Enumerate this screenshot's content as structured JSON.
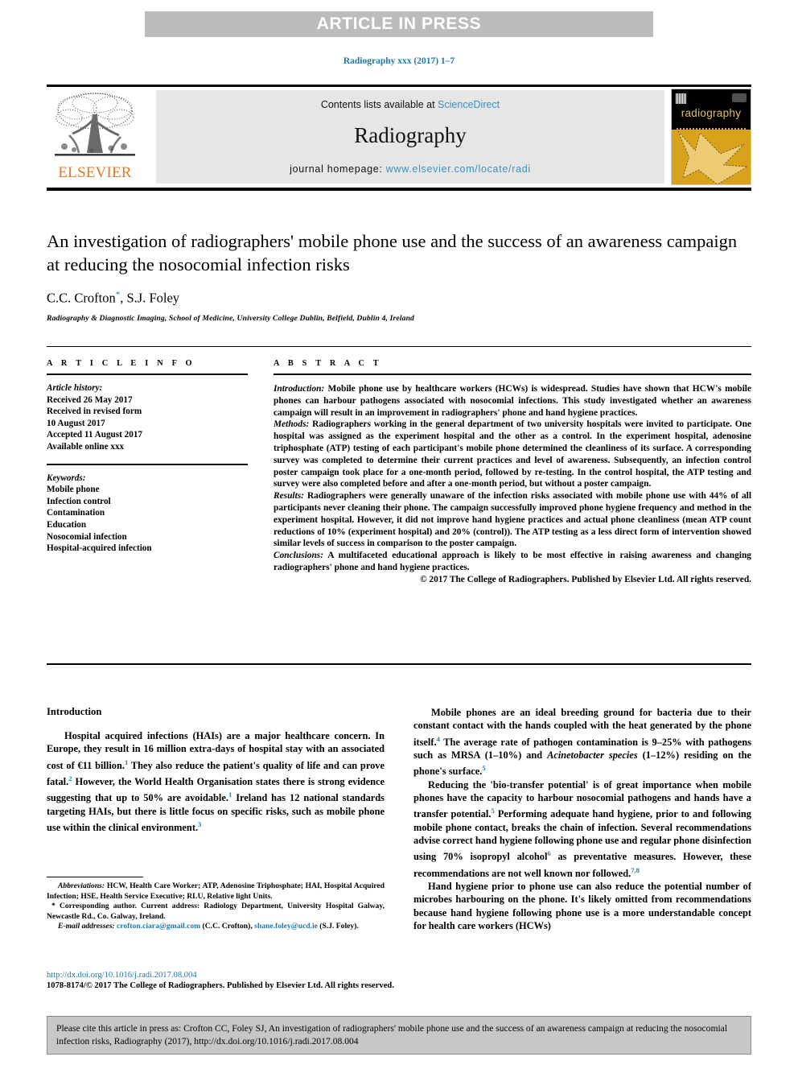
{
  "banner": {
    "text": "ARTICLE IN PRESS"
  },
  "journal_ref": "Radiography xxx (2017) 1–7",
  "masthead": {
    "publisher": "ELSEVIER",
    "contents_prefix": "Contents lists available at ",
    "contents_link": "ScienceDirect",
    "journal_title": "Radiography",
    "homepage_prefix": "journal homepage: ",
    "homepage_link": "www.elsevier.com/locate/radi",
    "cover_brand": "radiography"
  },
  "article": {
    "title": "An investigation of radiographers' mobile phone use and the success of an awareness campaign at reducing the nosocomial infection risks",
    "authors": "C.C. Crofton",
    "author_star": "*",
    "authors_rest": ", S.J. Foley",
    "affiliation": "Radiography & Diagnostic Imaging, School of Medicine, University College Dublin, Belfield, Dublin 4, Ireland"
  },
  "info": {
    "heading": "A R T I C L E  I N F O",
    "history_label": "Article history:",
    "history": [
      "Received 26 May 2017",
      "Received in revised form",
      "10 August 2017",
      "Accepted 11 August 2017",
      "Available online xxx"
    ],
    "keywords_label": "Keywords:",
    "keywords": [
      "Mobile phone",
      "Infection control",
      "Contamination",
      "Education",
      "Nosocomial infection",
      "Hospital-acquired infection"
    ]
  },
  "abstract": {
    "heading": "A B S T R A C T",
    "introduction_label": "Introduction:",
    "introduction_text": " Mobile phone use by healthcare workers (HCWs) is widespread. Studies have shown that HCW's mobile phones can harbour pathogens associated with nosocomial infections. This study investigated whether an awareness campaign will result in an improvement in radiographers' phone and hand hygiene practices.",
    "methods_label": "Methods:",
    "methods_text": " Radiographers working in the general department of two university hospitals were invited to participate. One hospital was assigned as the experiment hospital and the other as a control. In the experiment hospital, adenosine triphosphate (ATP) testing of each participant's mobile phone determined the cleanliness of its surface. A corresponding survey was completed to determine their current practices and level of awareness. Subsequently, an infection control poster campaign took place for a one-month period, followed by re-testing. In the control hospital, the ATP testing and survey were also completed before and after a one-month period, but without a poster campaign.",
    "results_label": "Results:",
    "results_text": " Radiographers were generally unaware of the infection risks associated with mobile phone use with 44% of all participants never cleaning their phone. The campaign successfully improved phone hygiene frequency and method in the experiment hospital. However, it did not improve hand hygiene practices and actual phone cleanliness (mean ATP count reductions of 10% (experiment hospital) and 20% (control)). The ATP testing as a less direct form of intervention showed similar levels of success in comparison to the poster campaign.",
    "conclusions_label": "Conclusions:",
    "conclusions_text": " A multifaceted educational approach is likely to be most effective in raising awareness and changing radiographers' phone and hand hygiene practices.",
    "copyright": "© 2017 The College of Radiographers. Published by Elsevier Ltd. All rights reserved."
  },
  "body": {
    "intro_heading": "Introduction",
    "left_p1_a": "Hospital acquired infections (HAIs) are a major healthcare concern. In Europe, they result in 16 million extra-days of hospital stay with an associated cost of €11 billion.",
    "left_p1_ref1": "1",
    "left_p1_b": " They also reduce the patient's quality of life and can prove fatal.",
    "left_p1_ref2": "2",
    "left_p1_c": " However, the World Health Organisation states there is strong evidence suggesting that up to 50% are avoidable.",
    "left_p1_ref3": "1",
    "left_p1_d": " Ireland has 12 national standards targeting HAIs, but there is little focus on specific risks, such as mobile phone use within the clinical environment.",
    "left_p1_ref4": "3",
    "right_p1_a": "Mobile phones are an ideal breeding ground for bacteria due to their constant contact with the hands coupled with the heat generated by the phone itself.",
    "right_p1_ref1": "4",
    "right_p1_b": " The average rate of pathogen contamination is 9–25% with pathogens such as MRSA (1–10%) and ",
    "right_p1_italic": "Acinetobacter species",
    "right_p1_c": " (1–12%) residing on the phone's surface.",
    "right_p1_ref2": "5",
    "right_p2_a": "Reducing the 'bio-transfer potential' is of great importance when mobile phones have the capacity to harbour nosocomial pathogens and hands have a transfer potential.",
    "right_p2_ref1": "5",
    "right_p2_b": " Performing adequate hand hygiene, prior to and following mobile phone contact, breaks the chain of infection. Several recommendations advise correct hand hygiene following phone use and regular phone disinfection using 70% isopropyl alcohol",
    "right_p2_ref2": "6",
    "right_p2_c": " as preventative measures. However, these recommendations are not well known nor followed.",
    "right_p2_ref3": "7,8",
    "right_p3": "Hand hygiene prior to phone use can also reduce the potential number of microbes harbouring on the phone. It's likely omitted from recommendations because hand hygiene following phone use is a more understandable concept for health care workers (HCWs)"
  },
  "footnotes": {
    "abbrev_label": "Abbreviations:",
    "abbrev_text": " HCW, Health Care Worker; ATP, Adenosine Triphosphate; HAI, Hospital Acquired Infection; HSE, Health Service Executive; RLU, Relative light Units.",
    "corresponding_star": "*",
    "corresponding_text": " Corresponding author. Current address: Radiology Department, University Hospital Galway, Newcastle Rd., Co. Galway, Ireland.",
    "email_label": "E-mail addresses:",
    "email1": "crofton.ciara@gmail.com",
    "email1_name": " (C.C. Crofton), ",
    "email2": "shane.foley@ucd.ie",
    "email2_name": " (S.J. Foley)."
  },
  "doi": {
    "link": "http://dx.doi.org/10.1016/j.radi.2017.08.004",
    "issn_line": "1078-8174/© 2017 The College of Radiographers. Published by Elsevier Ltd. All rights reserved."
  },
  "citation": {
    "text": "Please cite this article in press as: Crofton CC, Foley SJ, An investigation of radiographers' mobile phone use and the success of an awareness campaign at reducing the nosocomial infection risks, Radiography (2017), http://dx.doi.org/10.1016/j.radi.2017.08.004"
  },
  "colors": {
    "link": "#1a7aad",
    "banner_bg": "#bcbcbc",
    "masthead_bg": "#e6e6e6",
    "elsevier_orange": "#e87722",
    "cover_gold": "#d8a21a",
    "citation_bg": "#c7c7c7"
  }
}
